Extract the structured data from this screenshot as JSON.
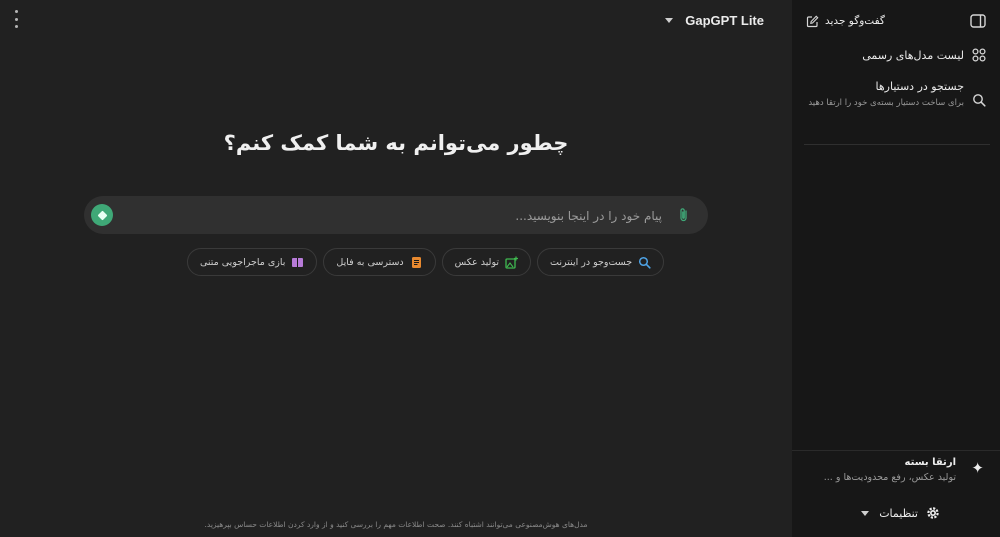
{
  "header": {
    "model_name": "GapGPT Lite"
  },
  "main": {
    "heading": "چطور می‌توانم به شما کمک کنم؟",
    "composer": {
      "placeholder": "پیام خود را در اینجا بنویسید..."
    },
    "chips": [
      {
        "label": "جست‌وجو در اینترنت",
        "icon": "search-icon",
        "color": "#4ea3e6"
      },
      {
        "label": "تولید عکس",
        "icon": "image-plus-icon",
        "color": "#3fb950"
      },
      {
        "label": "دسترسی به فایل",
        "icon": "file-icon",
        "color": "#e8892f"
      },
      {
        "label": "بازی ماجراجویی متنی",
        "icon": "book-icon",
        "color": "#b77bd8"
      }
    ],
    "disclaimer": "مدل‌های هوش‌مصنوعی می‌توانند اشتباه کنند. صحت اطلاعات مهم را بررسی کنید و از وارد کردن اطلاعات حساس بپرهیزید."
  },
  "sidebar": {
    "new_chat": "گفت‌وگو جدید",
    "models_list": "لیست مدل‌های رسمی",
    "search": {
      "title": "جستجو در دستیارها",
      "subtitle": "برای ساخت دستیار بسته‌ی خود را ارتقا دهید"
    },
    "upgrade": {
      "title": "ارتقا بسته",
      "subtitle": "تولید عکس، رفع محدودیت‌ها و ..."
    },
    "settings": "تنظیمات"
  },
  "colors": {
    "accent": "#3fa877",
    "background": "#212121",
    "sidebar": "#171717"
  }
}
